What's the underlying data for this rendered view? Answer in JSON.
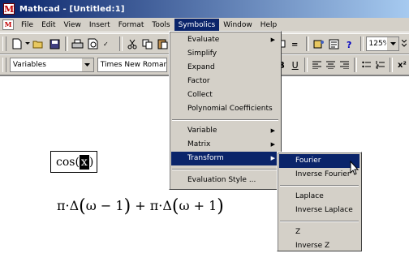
{
  "window": {
    "title": "Mathcad - [Untitled:1]"
  },
  "menubar": {
    "items": [
      "File",
      "Edit",
      "View",
      "Insert",
      "Format",
      "Tools",
      "Symbolics",
      "Window",
      "Help"
    ],
    "active": "Symbolics"
  },
  "format_toolbar": {
    "style": "Variables",
    "font": "Times New Roman",
    "bold": "B",
    "underline": "U",
    "superscript": "x²"
  },
  "standard_toolbar": {
    "zoom": "125%"
  },
  "symbolics_menu": {
    "items": [
      {
        "label": "Evaluate",
        "submenu": true
      },
      {
        "label": "Simplify",
        "submenu": false
      },
      {
        "label": "Expand",
        "submenu": false
      },
      {
        "label": "Factor",
        "submenu": false
      },
      {
        "label": "Collect",
        "submenu": false
      },
      {
        "label": "Polynomial Coefficients",
        "submenu": false
      },
      {
        "label": "Variable",
        "submenu": true
      },
      {
        "label": "Matrix",
        "submenu": true
      },
      {
        "label": "Transform",
        "submenu": true,
        "highlighted": true
      },
      {
        "label": "Evaluation Style ...",
        "submenu": false
      }
    ]
  },
  "transform_menu": {
    "items": [
      {
        "label": "Fourier",
        "highlighted": true
      },
      {
        "label": "Inverse Fourier"
      },
      {
        "label": "Laplace"
      },
      {
        "label": "Inverse Laplace"
      },
      {
        "label": "Z"
      },
      {
        "label": "Inverse Z"
      }
    ]
  },
  "document": {
    "expression_func": "cos(",
    "expression_var": "x",
    "expression_close": ")",
    "result": {
      "t1": "π·Δ",
      "t2": "ω − 1",
      "t3": " + π·Δ",
      "t4": "ω + 1"
    }
  },
  "colors": {
    "title_gradient_start": "#0a246a",
    "title_gradient_end": "#a6caf0",
    "highlight": "#0a246a",
    "chrome": "#d4d0c8"
  }
}
